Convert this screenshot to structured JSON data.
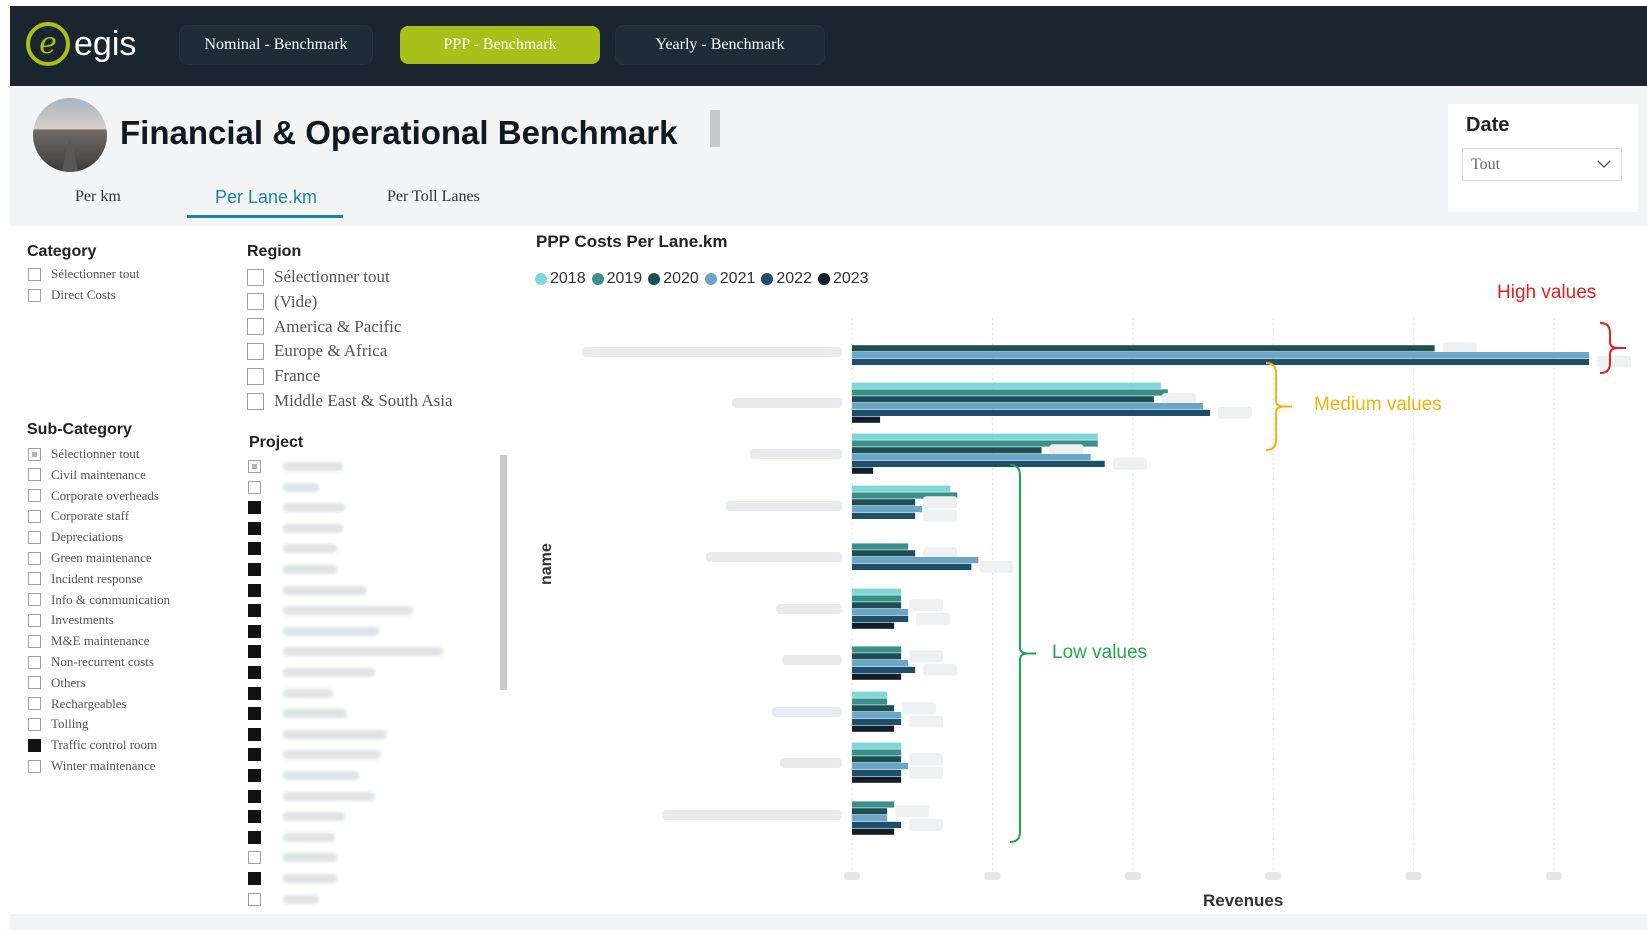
{
  "brand": {
    "logo_text": "egis",
    "logo_mark": "e"
  },
  "nav": {
    "items": [
      {
        "label": "Nominal - Benchmark",
        "active": false
      },
      {
        "label": "PPP - Benchmark",
        "active": true
      },
      {
        "label": "Yearly - Benchmark",
        "active": false
      }
    ]
  },
  "header": {
    "title": "Financial & Operational Benchmark",
    "tabs": [
      {
        "label": "Per km",
        "active": false
      },
      {
        "label": "Per Lane.km",
        "active": true
      },
      {
        "label": "Per Toll Lanes",
        "active": false
      }
    ]
  },
  "date_filter": {
    "label": "Date",
    "value": "Tout"
  },
  "category": {
    "title": "Category",
    "options": [
      {
        "label": "Sélectionner tout",
        "state": "empty"
      },
      {
        "label": "Direct Costs",
        "state": "empty"
      }
    ]
  },
  "subcategory": {
    "title": "Sub-Category",
    "options": [
      {
        "label": "Sélectionner tout",
        "state": "partial"
      },
      {
        "label": "Civil maintenance",
        "state": "empty"
      },
      {
        "label": "Corporate overheads",
        "state": "empty"
      },
      {
        "label": "Corporate staff",
        "state": "empty"
      },
      {
        "label": "Depreciations",
        "state": "empty"
      },
      {
        "label": "Green maintenance",
        "state": "empty"
      },
      {
        "label": "Incident response",
        "state": "empty"
      },
      {
        "label": "Info & communication",
        "state": "empty"
      },
      {
        "label": "Investments",
        "state": "empty"
      },
      {
        "label": "M&E maintenance",
        "state": "empty"
      },
      {
        "label": "Non-recurrent costs",
        "state": "empty"
      },
      {
        "label": "Others",
        "state": "empty"
      },
      {
        "label": "Rechargeables",
        "state": "empty"
      },
      {
        "label": "Tolling",
        "state": "empty"
      },
      {
        "label": "Traffic control room",
        "state": "filled"
      },
      {
        "label": "Winter maintenance",
        "state": "empty"
      }
    ]
  },
  "region": {
    "title": "Region",
    "options": [
      {
        "label": "Sélectionner tout",
        "state": "empty"
      },
      {
        "label": "(Vide)",
        "state": "empty"
      },
      {
        "label": "America & Pacific",
        "state": "empty"
      },
      {
        "label": "Europe & Africa",
        "state": "empty"
      },
      {
        "label": "France",
        "state": "empty"
      },
      {
        "label": "Middle East & South Asia",
        "state": "empty"
      }
    ]
  },
  "project": {
    "title": "Project",
    "rows": [
      "partial",
      "empty",
      "filled",
      "filled",
      "filled",
      "filled",
      "filled",
      "filled",
      "filled",
      "filled",
      "filled",
      "filled",
      "filled",
      "filled",
      "filled",
      "filled",
      "filled",
      "filled",
      "filled",
      "empty",
      "filled",
      "empty"
    ]
  },
  "chart": {
    "title": "PPP Costs Per Lane.km",
    "y_axis_label": "name",
    "x_axis_label": "Revenues",
    "legend": [
      {
        "label": "2018",
        "color": "#7fd6d6"
      },
      {
        "label": "2019",
        "color": "#3a8f8a"
      },
      {
        "label": "2020",
        "color": "#1b4f55"
      },
      {
        "label": "2021",
        "color": "#6aa6c6"
      },
      {
        "label": "2022",
        "color": "#1d4e6b"
      },
      {
        "label": "2023",
        "color": "#0f1e2b"
      }
    ],
    "annotations": {
      "high": {
        "label": "High values",
        "color": "#e02020"
      },
      "medium": {
        "label": "Medium values",
        "color": "#f2b40c"
      },
      "low": {
        "label": "Low values",
        "color": "#23a64a"
      }
    }
  },
  "chart_data": {
    "type": "bar",
    "orientation": "horizontal",
    "title": "PPP Costs Per Lane.km",
    "xlabel": "Revenues",
    "ylabel": "name",
    "categories_blurred": true,
    "xlim": [
      0,
      100
    ],
    "grid": true,
    "legend_position": "top-left",
    "series": [
      {
        "name": "2018",
        "values": [
          null,
          44,
          35,
          14,
          null,
          7,
          null,
          5,
          7,
          null
        ]
      },
      {
        "name": "2019",
        "values": [
          null,
          45,
          35,
          15,
          8,
          7,
          7,
          5,
          7,
          6
        ]
      },
      {
        "name": "2020",
        "values": [
          83,
          43,
          27,
          9,
          9,
          7,
          7,
          6,
          7,
          5
        ]
      },
      {
        "name": "2021",
        "values": [
          105,
          50,
          34,
          10,
          18,
          8,
          8,
          7,
          8,
          5
        ]
      },
      {
        "name": "2022",
        "values": [
          105,
          51,
          36,
          9,
          17,
          8,
          9,
          7,
          7,
          7
        ]
      },
      {
        "name": "2023",
        "values": [
          null,
          4,
          3,
          null,
          null,
          6,
          7,
          6,
          7,
          6
        ]
      }
    ]
  }
}
